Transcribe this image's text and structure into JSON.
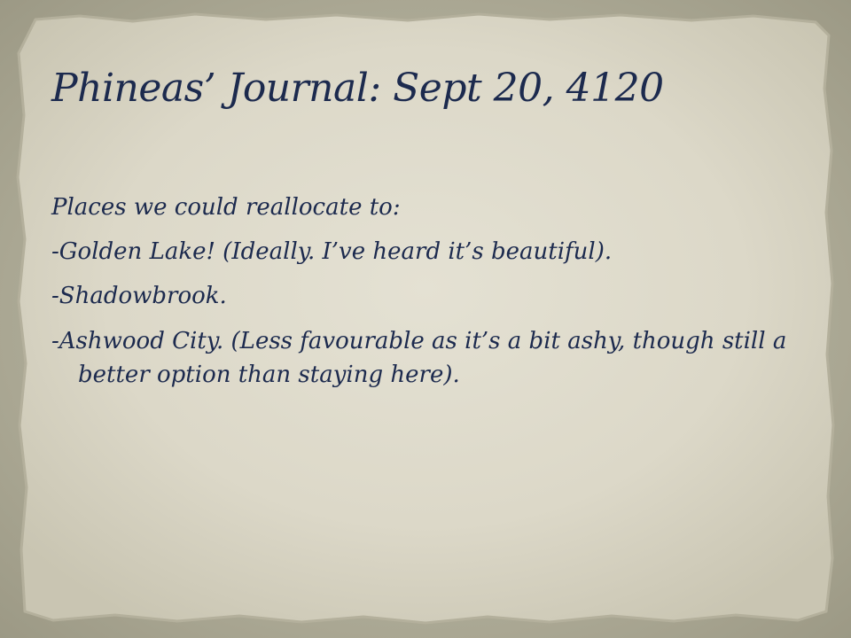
{
  "slide": {
    "title": "Phineas’ Journal: Sept 20, 4120",
    "lines": [
      "Places we could reallocate to:",
      "-Golden Lake! (Ideally. I’ve heard it’s beautiful).",
      "-Shadowbrook.",
      "-Ashwood City. (Less favourable as it’s a bit ashy, though still a better  option than staying here)."
    ]
  },
  "colors": {
    "background": "#a9a795",
    "paper": "#e2dfd1",
    "ink": "#1c2a4e"
  }
}
